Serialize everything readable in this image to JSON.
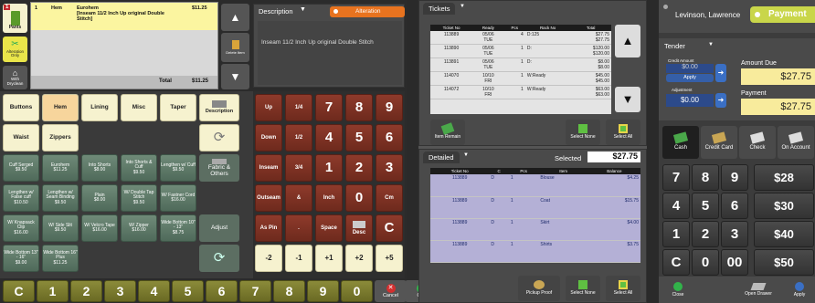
{
  "left": {
    "category_badge": "1",
    "category_label": "Pants",
    "alteration_only": "Alteration Only",
    "with_dryclean": "With Dryclean",
    "order_line": {
      "qty": "1",
      "item": "Hem",
      "desc": "Eurohem\n[Inseam 11/2 Inch Up original Double Stitch]",
      "price": "$11.25"
    },
    "total_label": "Total",
    "total_value": "$11.25",
    "delete_item": "Delete Item",
    "description_title": "Description",
    "alteration_tab": "Alteration",
    "description_text": "Inseam 11/2 Inch Up original Double Stitch",
    "categories": [
      "Buttons",
      "Hem",
      "Lining",
      "Misc",
      "Taper"
    ],
    "desc_btn": "Description",
    "row2": [
      "Waist",
      "Zippers"
    ],
    "services": [
      {
        "name": "Cuff Serged",
        "price": "$9.50"
      },
      {
        "name": "Eurohem",
        "price": "$11.25"
      },
      {
        "name": "Into Shorts",
        "price": "$8.00"
      },
      {
        "name": "Into Shorts & Cuff",
        "price": "$9.50"
      },
      {
        "name": "Lengthen w/ Cuff",
        "price": "$9.50"
      },
      {
        "name": "Lengthen w/ False cuff",
        "price": "$10.50"
      },
      {
        "name": "Lengthen w/ Seam Binding",
        "price": "$9.50"
      },
      {
        "name": "Plain",
        "price": "$8.00"
      },
      {
        "name": "W/ Double Tap Stitch",
        "price": "$9.50"
      },
      {
        "name": "W/ Fastner Cord",
        "price": "$16.00"
      },
      {
        "name": "W/ Knapsack Clip",
        "price": "$16.00"
      },
      {
        "name": "W/ Side Slit",
        "price": "$9.50"
      },
      {
        "name": "W/ Velcro Tape",
        "price": "$16.00"
      },
      {
        "name": "W/ Zipper",
        "price": "$16.00"
      },
      {
        "name": "Wide Bottom 10\" - 13\"",
        "price": "$8.75"
      },
      {
        "name": "Wide Bottom 13\" - 16\"",
        "price": "$9.00"
      },
      {
        "name": "Wide Bottom 16\" Plus",
        "price": "$11.25"
      }
    ],
    "fabric": "Fabric & Others",
    "adjust": "Adjust",
    "measure": {
      "up": "Up",
      "down": "Down",
      "inseam": "Inseam",
      "outseam": "Outseam",
      "aspin": "As Pin",
      "q1": "1/4",
      "q2": "1/2",
      "q3": "3/4",
      "amp": "&",
      "dot": ".",
      "inch": "Inch",
      "space": "Space",
      "cm": "Cm",
      "desc": "Desc",
      "c": "C",
      "n7": "7",
      "n8": "8",
      "n9": "9",
      "n4": "4",
      "n5": "5",
      "n6": "6",
      "n1": "1",
      "n2": "2",
      "n3": "3",
      "n0": "0"
    },
    "adj": [
      "-2",
      "-1",
      "+1",
      "+2",
      "+5"
    ],
    "bottom_keys": [
      "C",
      "1",
      "2",
      "3",
      "4",
      "5",
      "6",
      "7",
      "8",
      "9",
      "0"
    ],
    "cancel": "Cancel",
    "ok": "OK"
  },
  "middle": {
    "tickets_title": "Tickets",
    "cols": [
      "Ticket No",
      "Ready",
      "Pcs",
      "Rack No",
      "Total"
    ],
    "tickets": [
      {
        "no": "113889",
        "ready": "05/06\nTUE",
        "pcs": "4",
        "rack": "D:125",
        "total": "$27.75\n$27.75"
      },
      {
        "no": "113890",
        "ready": "05/06\nTUE",
        "pcs": "1",
        "rack": "D:",
        "total": "$120.00\n$120.00"
      },
      {
        "no": "113891",
        "ready": "05/06\nTUE",
        "pcs": "1",
        "rack": "D:",
        "total": "$8.00\n$8.00"
      },
      {
        "no": "114070",
        "ready": "10/10\nFRI",
        "pcs": "1",
        "rack": "W:Ready",
        "total": "$45.00\n$45.00"
      },
      {
        "no": "114072",
        "ready": "10/10\nFRI",
        "pcs": "1",
        "rack": "W:Ready",
        "total": "$63.00\n$63.00"
      }
    ],
    "item_remain": "Item Remain",
    "select_none": "Select None",
    "select_all": "Select All",
    "detailed_title": "Detailed",
    "selected_label": "Selected",
    "selected_value": "$27.75",
    "dcols": [
      "Ticket No",
      "C",
      "Pcs",
      "Item",
      "Balance"
    ],
    "details": [
      {
        "no": "113889",
        "c": "D",
        "pcs": "1",
        "item": "Blouse",
        "bal": "$4.25"
      },
      {
        "no": "113889",
        "c": "D",
        "pcs": "1",
        "item": "Coat",
        "bal": "$15.75"
      },
      {
        "no": "113889",
        "c": "D",
        "pcs": "1",
        "item": "Skirt",
        "bal": "$4.00"
      },
      {
        "no": "113889",
        "c": "D",
        "pcs": "1",
        "item": "Shirts",
        "bal": "$3.75"
      }
    ],
    "pickup_proof": "Pickup Proof",
    "select_none2": "Select None",
    "select_all2": "Select All"
  },
  "right": {
    "customer": "Levinson, Lawrence",
    "payment": "Payment",
    "tender": "Tender",
    "credit_amount_label": "Credit Amount",
    "credit_amount": "$0.00",
    "apply": "Apply",
    "adjustment_label": "Adjustment",
    "adjustment": "$0.00",
    "amount_due_label": "Amount Due",
    "amount_due": "$27.75",
    "payment_label": "Payment",
    "payment_value": "$27.75",
    "methods": [
      "Cash",
      "Credit Card",
      "Check",
      "On Account"
    ],
    "keys": [
      "7",
      "8",
      "9",
      "4",
      "5",
      "6",
      "1",
      "2",
      "3",
      "C",
      "0",
      "00"
    ],
    "quick": [
      "$28",
      "$30",
      "$40",
      "$50"
    ],
    "close": "Close",
    "open_drawer": "Open Drawer",
    "apply_btn": "Apply"
  },
  "colors": {
    "accent_orange": "#e8731f",
    "yellow": "#f6f2cf",
    "maroon": "#7e3022",
    "green": "#56705f",
    "olive": "#7a7a2e"
  }
}
